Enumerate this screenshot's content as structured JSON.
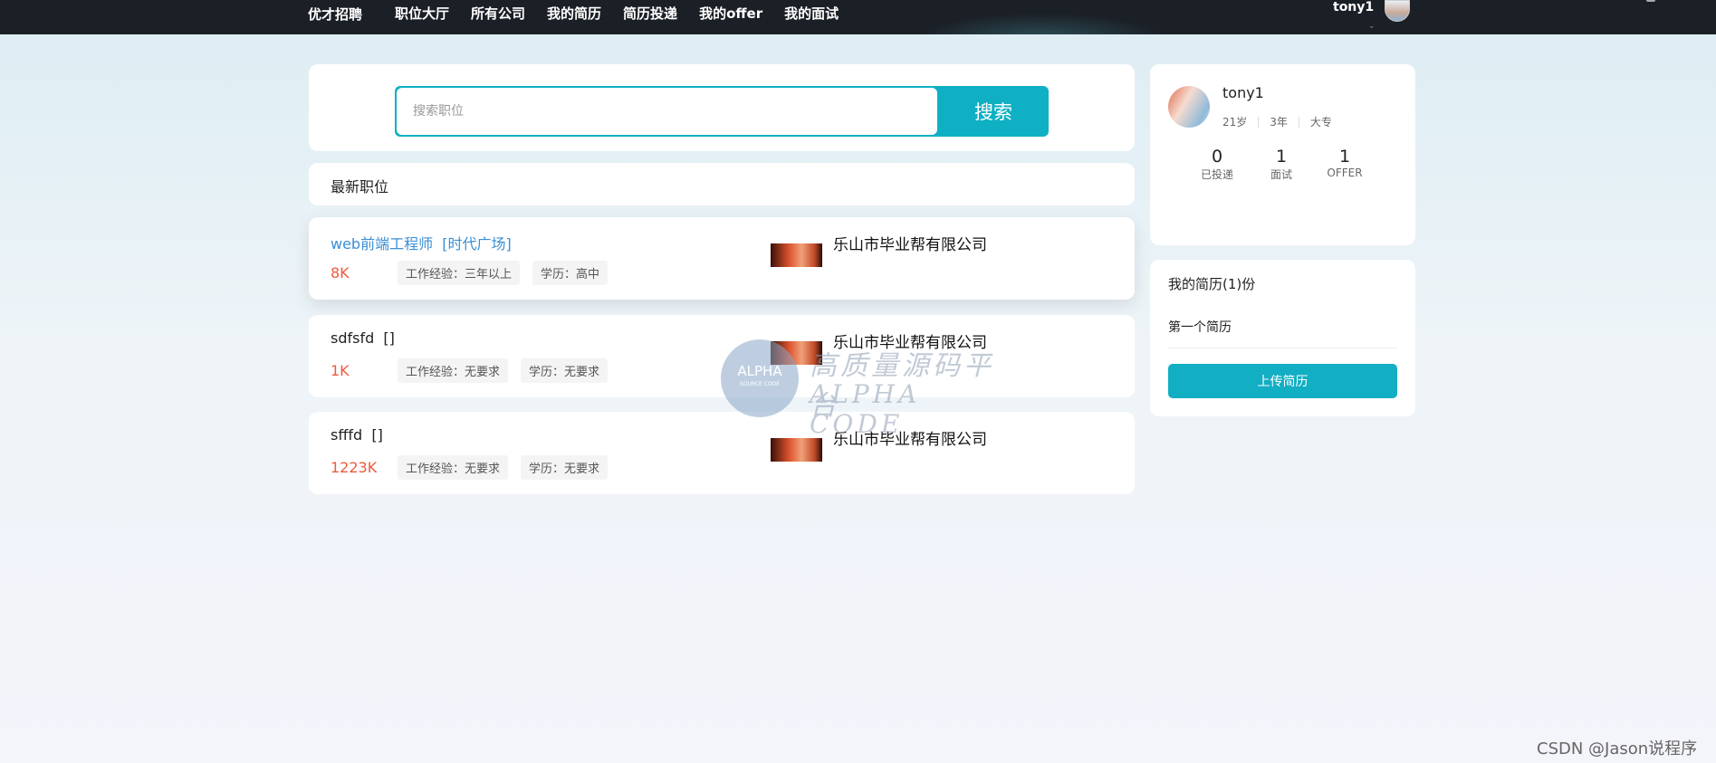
{
  "header": {
    "brand": "优才招聘",
    "nav": [
      "职位大厅",
      "所有公司",
      "我的简历",
      "简历投递",
      "我的offer",
      "我的面试"
    ],
    "username": "tony1"
  },
  "search": {
    "placeholder": "搜索职位",
    "button_label": "搜索"
  },
  "latest": {
    "title": "最新职位"
  },
  "jobs": [
    {
      "title": "web前端工程师",
      "location": "[时代广场]",
      "salary": "8K",
      "experience": "工作经验：三年以上",
      "education": "学历：高中",
      "company": "乐山市毕业帮有限公司"
    },
    {
      "title": "sdfsfd",
      "location": "[]",
      "salary": "1K",
      "experience": "工作经验：无要求",
      "education": "学历：无要求",
      "company": "乐山市毕业帮有限公司"
    },
    {
      "title": "sfffd",
      "location": "[]",
      "salary": "1223K",
      "experience": "工作经验：无要求",
      "education": "学历：无要求",
      "company": "乐山市毕业帮有限公司"
    }
  ],
  "profile": {
    "name": "tony1",
    "age": "21岁",
    "experience": "3年",
    "education": "大专",
    "stats": [
      {
        "value": "0",
        "label": "已投递"
      },
      {
        "value": "1",
        "label": "面试"
      },
      {
        "value": "1",
        "label": "OFFER"
      }
    ]
  },
  "resume": {
    "title": "我的简历(1)份",
    "items": [
      "第一个简历"
    ],
    "upload_label": "上传简历"
  },
  "watermark": {
    "circle_top": "ALPHA",
    "circle_sub": "SOURCE CODE",
    "line1": "高质量源码平台",
    "line2": "ALPHA CODE"
  },
  "footer": {
    "credit": "CSDN @Jason说程序"
  },
  "colors": {
    "accent": "#12aec4",
    "salary": "#ef5a3c",
    "link_blue": "#3a8fd6",
    "nav_bg": "#1b1f26"
  }
}
